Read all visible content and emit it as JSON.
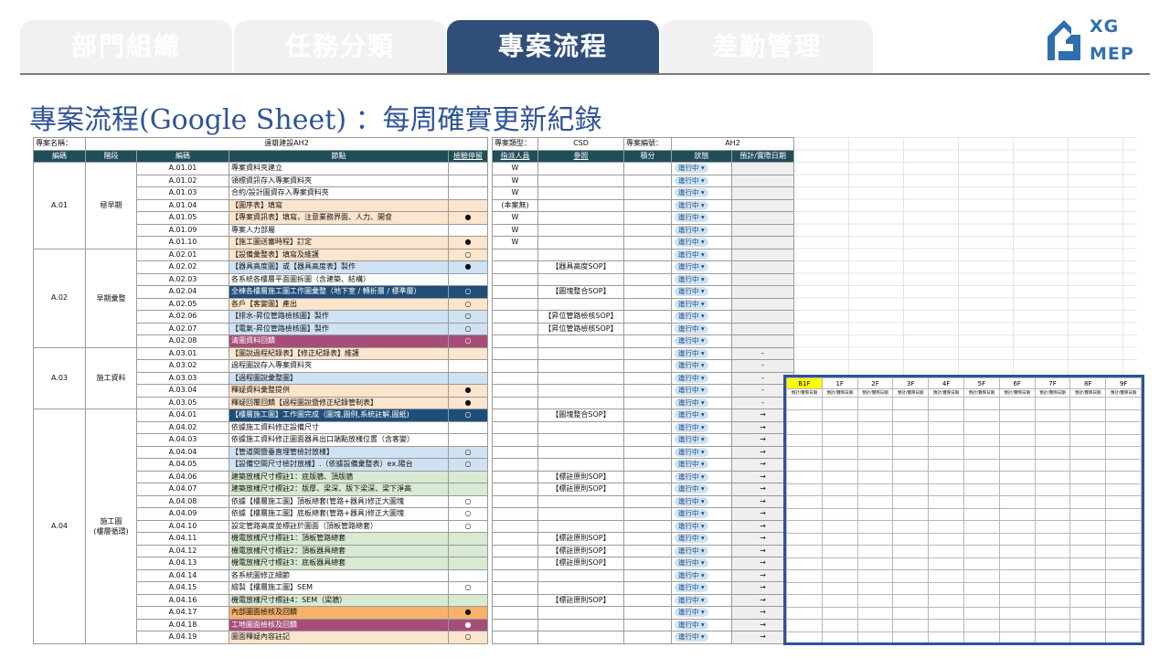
{
  "tabs": [
    {
      "label": "部門組織",
      "active": false
    },
    {
      "label": "任務分類",
      "active": false
    },
    {
      "label": "專案流程",
      "active": true
    },
    {
      "label": "差勤管理",
      "active": false
    }
  ],
  "logo": {
    "line1": "XG",
    "line2": "MEP"
  },
  "title": "專案流程(Google Sheet) ：每周確實更新紀錄",
  "sheet": {
    "meta": {
      "project_name_label": "專案名稱：",
      "project_name": "遠雄建設AH2",
      "project_type_label": "專案類型：",
      "project_type": "CSD",
      "project_no_label": "專案編號：",
      "project_no": "AH2"
    },
    "columns": {
      "code": "編碼",
      "stage": "階段",
      "node_code": "編碼",
      "node": "節點",
      "check": "檢驗停留",
      "assignee": "指派人員",
      "ref": "參照",
      "score": "積分",
      "status": "狀態",
      "date": "預計/實際日期"
    },
    "groups": [
      {
        "code": "A.01",
        "stage": "極早期",
        "rows": [
          {
            "no": "A.01.01",
            "node": "專案資料夾建立",
            "mark": "",
            "who": "W",
            "ref": "",
            "status": "進行中",
            "date": "",
            "bg": ""
          },
          {
            "no": "A.01.02",
            "node": "領標資訊存入專案資料夾",
            "mark": "",
            "who": "W",
            "ref": "",
            "status": "進行中",
            "date": "",
            "bg": ""
          },
          {
            "no": "A.01.03",
            "node": "合約/設計圖資存入專案資料夾",
            "mark": "",
            "who": "W",
            "ref": "",
            "status": "進行中",
            "date": "",
            "bg": ""
          },
          {
            "no": "A.01.04",
            "node": "【圖序表】填寫",
            "mark": "",
            "who": "(本案無)",
            "ref": "",
            "status": "進行中",
            "date": "",
            "bg": "orange"
          },
          {
            "no": "A.01.05",
            "node": "【專案資訊表】填寫，注意業務界面、人力、開會",
            "mark": "●",
            "who": "W",
            "ref": "",
            "status": "進行中",
            "date": "",
            "bg": "orange"
          },
          {
            "no": "A.01.09",
            "node": "專案人力部屬",
            "mark": "",
            "who": "W",
            "ref": "",
            "status": "進行中",
            "date": "",
            "bg": ""
          },
          {
            "no": "A.01.10",
            "node": "【施工圖送審時程】訂定",
            "mark": "●",
            "who": "W",
            "ref": "",
            "status": "進行中",
            "date": "",
            "bg": "orange"
          }
        ]
      },
      {
        "code": "A.02",
        "stage": "早期彙整",
        "rows": [
          {
            "no": "A.02.01",
            "node": "【設備彙整表】填寫及維護",
            "mark": "○",
            "who": "",
            "ref": "",
            "status": "進行中",
            "date": "",
            "bg": "orange"
          },
          {
            "no": "A.02.02",
            "node": "【器具高度圖】或【器具高度表】製作",
            "mark": "●",
            "who": "",
            "ref": "【器具高度SOP】",
            "status": "進行中",
            "date": "",
            "bg": "blue"
          },
          {
            "no": "A.02.03",
            "node": "各系統各樓層平面圖拆圖（含建築、結構）",
            "mark": "",
            "who": "",
            "ref": "",
            "status": "進行中",
            "date": "",
            "bg": ""
          },
          {
            "no": "A.02.04",
            "node": "全棟各樓層施工圖工作圖彙整（地下室 / 轉折層 / 標準層）",
            "mark": "○",
            "who": "",
            "ref": "【圖塊整合SOP】",
            "status": "進行中",
            "date": "",
            "bg": "navy"
          },
          {
            "no": "A.02.05",
            "node": "各戶【客變圖】產出",
            "mark": "○",
            "who": "",
            "ref": "",
            "status": "進行中",
            "date": "",
            "bg": "orange"
          },
          {
            "no": "A.02.06",
            "node": "【排水-昇位管路檢核圖】製作",
            "mark": "○",
            "who": "",
            "ref": "【昇位管路檢核SOP】",
            "status": "進行中",
            "date": "",
            "bg": "blue"
          },
          {
            "no": "A.02.07",
            "node": "【電氣-昇位管路檢核圖】製作",
            "mark": "○",
            "who": "",
            "ref": "【昇位管路檢核SOP】",
            "status": "進行中",
            "date": "",
            "bg": "blue"
          },
          {
            "no": "A.02.08",
            "node": "清圖資料回饋",
            "mark": "○",
            "who": "",
            "ref": "",
            "status": "進行中",
            "date": "",
            "bg": "mag"
          }
        ]
      },
      {
        "code": "A.03",
        "stage": "施工資料",
        "rows": [
          {
            "no": "A.03.01",
            "node": "【圖說過程紀錄表】【修正紀錄表】維護",
            "mark": "",
            "who": "",
            "ref": "",
            "status": "進行中",
            "date": "-",
            "bg": "orange"
          },
          {
            "no": "A.03.02",
            "node": "過程圖說存入專案資料夾",
            "mark": "",
            "who": "",
            "ref": "",
            "status": "進行中",
            "date": "-",
            "bg": ""
          },
          {
            "no": "A.03.03",
            "node": "【過程圖說彙整圖】",
            "mark": "",
            "who": "",
            "ref": "",
            "status": "進行中",
            "date": "-",
            "bg": "blue"
          },
          {
            "no": "A.03.04",
            "node": "釋疑資料彙整提供",
            "mark": "●",
            "who": "",
            "ref": "",
            "status": "進行中",
            "date": "-",
            "bg": "orange"
          },
          {
            "no": "A.03.05",
            "node": "釋疑回覆回饋【過程圖說暨修正紀錄管制表】",
            "mark": "●",
            "who": "",
            "ref": "",
            "status": "進行中",
            "date": "-",
            "bg": "orange"
          }
        ]
      },
      {
        "code": "A.04",
        "stage": "施工圖\n(樓層循環)",
        "rows": [
          {
            "no": "A.04.01",
            "node": "【樓層施工圖】工作圖完成（圖塊,圖例,系統註解,圖紙)",
            "mark": "○",
            "who": "",
            "ref": "【圖塊整合SOP】",
            "status": "進行中",
            "date": "→",
            "bg": "navy"
          },
          {
            "no": "A.04.02",
            "node": "依據施工資料修正設備尺寸",
            "mark": "",
            "who": "",
            "ref": "",
            "status": "進行中",
            "date": "→",
            "bg": ""
          },
          {
            "no": "A.04.03",
            "node": "依據施工資料修正圖面器具出口端點放樣位置（含客變）",
            "mark": "",
            "who": "",
            "ref": "",
            "status": "進行中",
            "date": "→",
            "bg": ""
          },
          {
            "no": "A.04.04",
            "node": "【管道間暨垂直埋管檢討放樣】",
            "mark": "○",
            "who": "",
            "ref": "",
            "status": "進行中",
            "date": "→",
            "bg": "blue"
          },
          {
            "no": "A.04.05",
            "node": "【設備空間尺寸檢討放樣】.（依據設備彙整表）ex.陽台",
            "mark": "○",
            "who": "",
            "ref": "",
            "status": "進行中",
            "date": "→",
            "bg": "blue"
          },
          {
            "no": "A.04.06",
            "node": "建築放樣尺寸標註1：底版牆、頂版牆",
            "mark": "",
            "who": "",
            "ref": "【標註原則SOP】",
            "status": "進行中",
            "date": "→",
            "bg": "green"
          },
          {
            "no": "A.04.07",
            "node": "建築放樣尺寸標註2：版厚、梁深、版下梁深、梁下淨高",
            "mark": "",
            "who": "",
            "ref": "【標註原則SOP】",
            "status": "進行中",
            "date": "→",
            "bg": "green"
          },
          {
            "no": "A.04.08",
            "node": "依據【樓層施工圖】頂板總套(管路+器具)修正大圖塊",
            "mark": "○",
            "who": "",
            "ref": "",
            "status": "進行中",
            "date": "→",
            "bg": ""
          },
          {
            "no": "A.04.09",
            "node": "依據【樓層施工圖】底板總套(管路+器具)修正大圖塊",
            "mark": "○",
            "who": "",
            "ref": "",
            "status": "進行中",
            "date": "→",
            "bg": ""
          },
          {
            "no": "A.04.10",
            "node": "設定管路高度並標註於圖面（頂板管路總套）",
            "mark": "○",
            "who": "",
            "ref": "",
            "status": "進行中",
            "date": "→",
            "bg": ""
          },
          {
            "no": "A.04.11",
            "node": "機電放樣尺寸標註1：頂板管路總套",
            "mark": "",
            "who": "",
            "ref": "【標註原則SOP】",
            "status": "進行中",
            "date": "→",
            "bg": "green"
          },
          {
            "no": "A.04.12",
            "node": "機電放樣尺寸標註2：頂板器具總套",
            "mark": "",
            "who": "",
            "ref": "【標註原則SOP】",
            "status": "進行中",
            "date": "→",
            "bg": "green"
          },
          {
            "no": "A.04.13",
            "node": "機電放樣尺寸標註3：底板器具總套",
            "mark": "",
            "who": "",
            "ref": "【標註原則SOP】",
            "status": "進行中",
            "date": "→",
            "bg": "green"
          },
          {
            "no": "A.04.14",
            "node": "各系統圖修正細節",
            "mark": "",
            "who": "",
            "ref": "",
            "status": "進行中",
            "date": "→",
            "bg": ""
          },
          {
            "no": "A.04.15",
            "node": "繪製【樓層施工圖】SEM",
            "mark": "○",
            "who": "",
            "ref": "",
            "status": "進行中",
            "date": "→",
            "bg": ""
          },
          {
            "no": "A.04.16",
            "node": "機電放樣尺寸標註4：SEM（梁牆）",
            "mark": "",
            "who": "",
            "ref": "【標註原則SOP】",
            "status": "進行中",
            "date": "→",
            "bg": "green"
          },
          {
            "no": "A.04.17",
            "node": "內部圖面檢核及回饋",
            "mark": "●",
            "who": "",
            "ref": "",
            "status": "進行中",
            "date": "→",
            "bg": "or2"
          },
          {
            "no": "A.04.18",
            "node": "工地圖面檢核及回饋",
            "mark": "●",
            "who": "",
            "ref": "",
            "status": "進行中",
            "date": "→",
            "bg": "mag"
          },
          {
            "no": "A.04.19",
            "node": "圖面釋疑內容註記",
            "mark": "○",
            "who": "",
            "ref": "",
            "status": "進行中",
            "date": "→",
            "bg": "orange"
          }
        ]
      }
    ]
  },
  "floors": {
    "labels": [
      "B1F",
      "1F",
      "2F",
      "3F",
      "4F",
      "5F",
      "6F",
      "7F",
      "8F",
      "9F"
    ],
    "sub_label": "預計/實際日期",
    "highlight": "B1F",
    "highlight_color": "#ffff00"
  },
  "colors": {
    "accent": "#2f4e79",
    "title": "#2f5496",
    "header_fill": "#1f4e5a"
  }
}
